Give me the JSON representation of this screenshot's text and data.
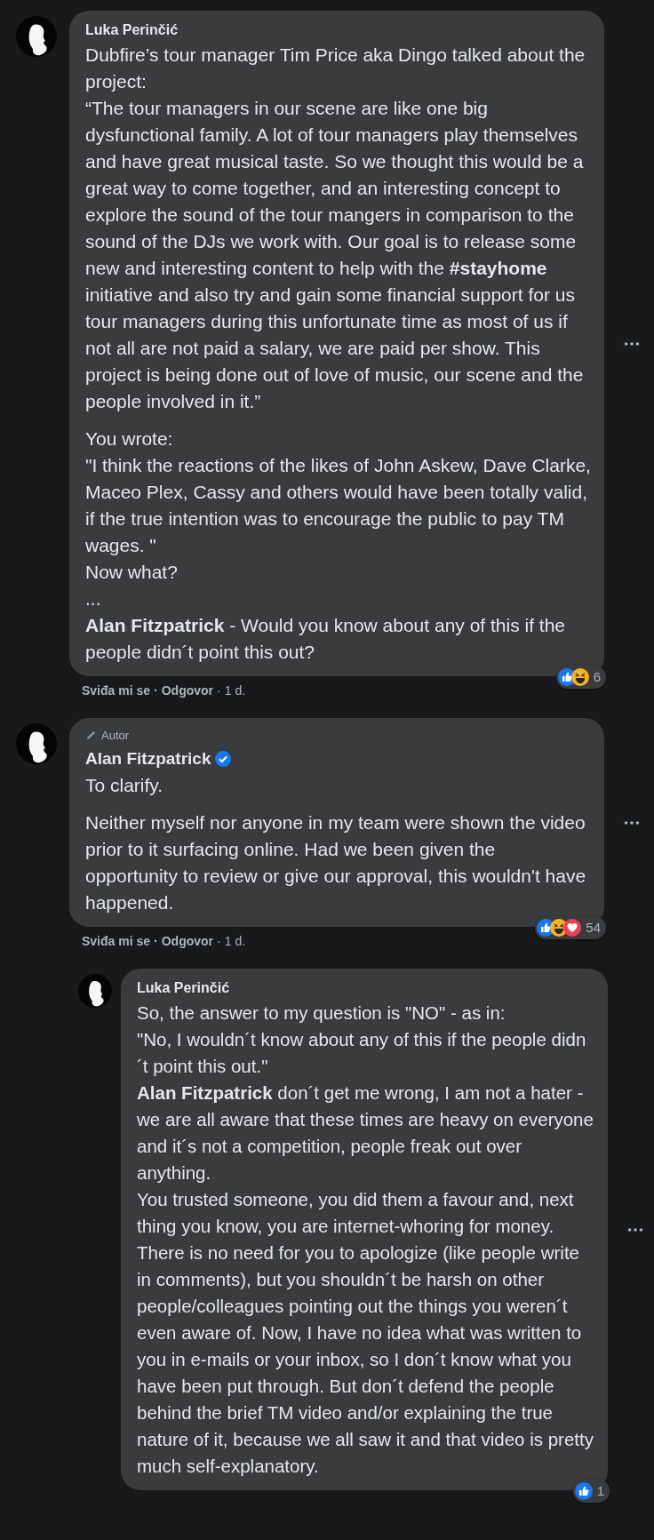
{
  "comments": [
    {
      "author": "Luka Perinčić",
      "reply": false,
      "verified": false,
      "paragraphs": [
        [
          "Dubfire’s tour manager Tim Price aka Dingo talked about the project:",
          "“The tour managers in our scene are like one big dysfunctional family. A lot of tour managers play themselves and have great musical taste. So we thought this would be a great way to come together, and an interesting concept to explore the sound of the tour mangers in comparison to the sound of the DJs we work with. Our goal is to release some new and interesting content to help with the **#stayhome** initiative and also try and gain some financial support for us tour managers during this unfortunate time as most of us if not all are not paid a salary, we are paid per show. This project is being done out of love of music, our scene and the people involved in it.”"
        ],
        [
          "You wrote:",
          "\"I think the reactions of the likes of John Askew, Dave Clarke, Maceo Plex, Cassy and others would have been totally valid, if the true intention was to encourage the public to pay TM wages. \"",
          "Now what?",
          "...",
          "**Alan Fitzpatrick** - Would you know about any of this if the people didn´t point this out?"
        ]
      ],
      "reactions": {
        "icons": [
          {
            "kind": "like"
          },
          {
            "kind": "haha"
          }
        ],
        "count": "6"
      },
      "meta": {
        "like": "Sviđa mi se",
        "sep1": "·",
        "reply": "Odgovor",
        "sep2": "·",
        "time": "1 d."
      }
    },
    {
      "author": "Alan Fitzpatrick",
      "reply": false,
      "author_badge": "Autor",
      "verified": true,
      "paragraphs": [
        [
          "To clarify."
        ],
        [
          "Neither myself nor anyone in my team were shown the video prior to it surfacing online. Had we been given the opportunity to review or give our approval, this wouldn't have happened."
        ]
      ],
      "reactions": {
        "icons": [
          {
            "kind": "like"
          },
          {
            "kind": "haha"
          },
          {
            "kind": "love"
          }
        ],
        "count": "54"
      },
      "meta": {
        "like": "Sviđa mi se",
        "sep1": "·",
        "reply": "Odgovor",
        "sep2": "·",
        "time": "1 d."
      }
    },
    {
      "author": "Luka Perinčić",
      "reply": true,
      "verified": false,
      "paragraphs": [
        [
          "So, the answer to my question is \"NO\" - as in:",
          "\"No, I wouldn´t know about any of this if the people didn´t point this out.\"",
          "**Alan Fitzpatrick** don´t get me wrong, I am not a hater - we are all aware that these times are heavy on everyone and it´s not a competition, people freak out over anything.",
          "You trusted someone, you did them a favour and, next thing you know, you are internet-whoring for money. There is no need for you to apologize (like people write in comments), but you shouldn´t be harsh on other people/colleagues pointing out the things you weren´t even aware of. Now, I have no idea what was written to you in e-mails or your inbox, so I don´t know what you have been put through. But don´t defend the people behind the brief TM video and/or explaining the true nature of it, because we all saw it and that video is pretty much self-explanatory."
        ]
      ],
      "reactions": {
        "icons": [
          {
            "kind": "like"
          }
        ],
        "count": "1"
      }
    }
  ]
}
